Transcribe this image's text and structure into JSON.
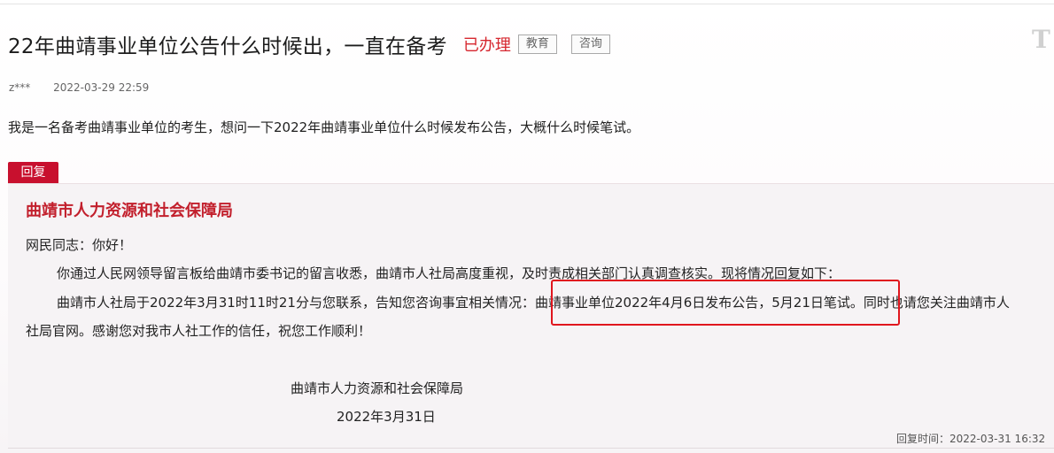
{
  "post": {
    "title": "22年曲靖事业单位公告什么时候出，一直在备考",
    "status": "已办理",
    "tags": [
      "教育",
      "咨询"
    ],
    "corner_mark": "T",
    "author": "z***",
    "datetime": "2022-03-29 22:59",
    "question": "我是一名备考曲靖事业单位的考生，想问一下2022年曲靖事业单位什么时候发布公告，大概什么时候笔试。"
  },
  "reply": {
    "badge": "回复",
    "org": "曲靖市人力资源和社会保障局",
    "greeting": "网民同志：你好！",
    "line1": "你通过人民网领导留言板给曲靖市委书记的留言收悉，曲靖市人社局高度重视，及时责成相关部门认真调查核实。现将情况回复如下：",
    "line2": "曲靖市人社局于2022年3月31时11时21分与您联系，告知您咨询事宜相关情况：曲靖事业单位2022年4月6日发布公告，5月21日笔试。同时也请您关注曲靖市人",
    "line3": "社局官网。感谢您对我市人社工作的信任，祝您工作顺利！",
    "signature_org": "曲靖市人力资源和社会保障局",
    "signature_date": "2022年3月31日",
    "reply_time": "回复时间：2022-03-31 16:32"
  },
  "colors": {
    "accent_red": "#c8102e",
    "status_red": "#d6262e",
    "highlight_border": "#e0161e"
  }
}
